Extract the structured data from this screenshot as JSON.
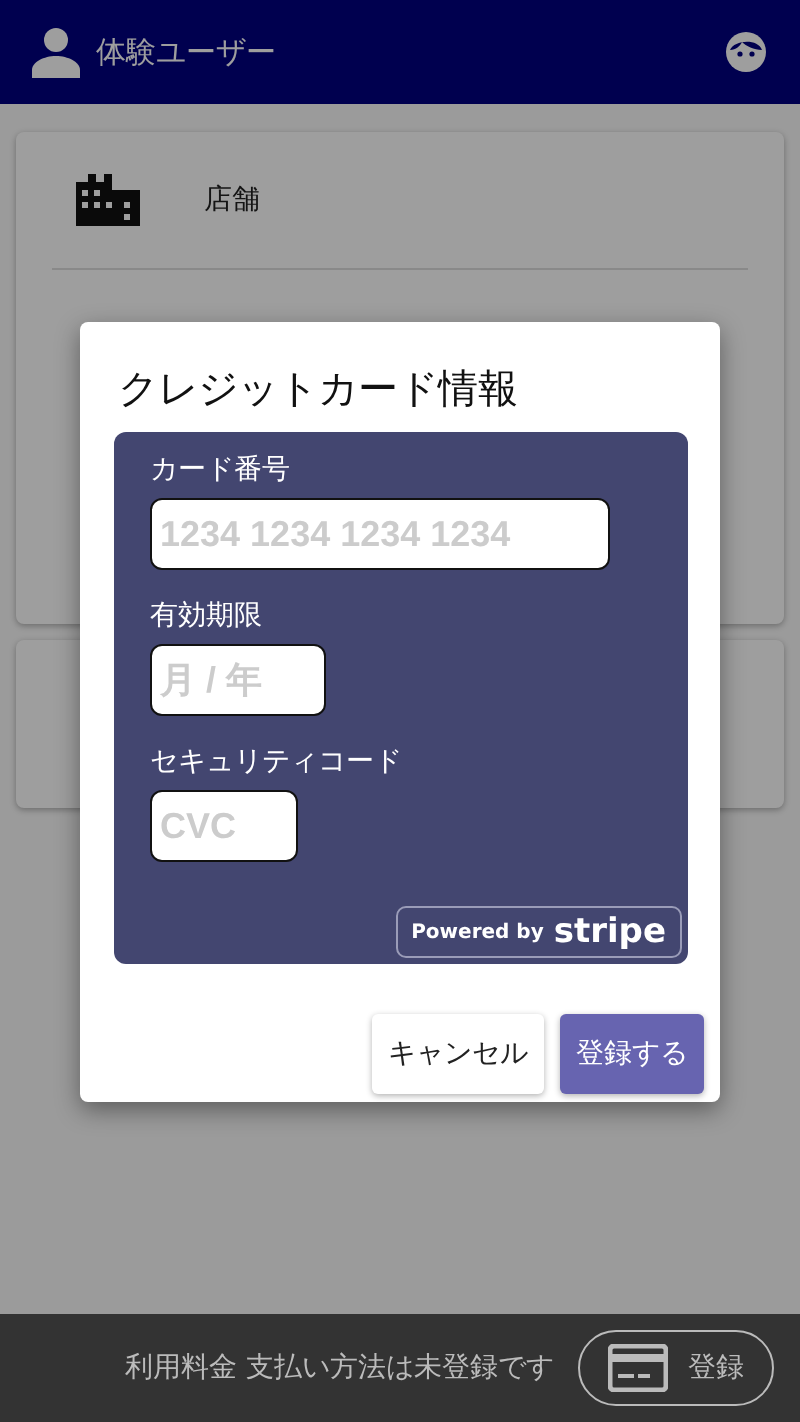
{
  "header": {
    "user_name": "体験ユーザー"
  },
  "store_card": {
    "label": "店舗"
  },
  "dialog": {
    "title": "クレジットカード情報",
    "fields": [
      {
        "label": "カード番号",
        "placeholder": "1234 1234 1234 1234",
        "kind": "wide"
      },
      {
        "label": "有効期限",
        "placeholder": "月 / 年",
        "kind": "medium"
      },
      {
        "label": "セキュリティコード",
        "placeholder": "CVC",
        "kind": "narrow"
      }
    ],
    "badge": {
      "prefix": "Powered by",
      "brand": "stripe"
    },
    "buttons": [
      {
        "label": "キャンセル",
        "kind": "secondary"
      },
      {
        "label": "登録する",
        "kind": "primary"
      }
    ]
  },
  "footer": {
    "message": "利用料金 支払い方法は未登録です",
    "button": "登録"
  }
}
